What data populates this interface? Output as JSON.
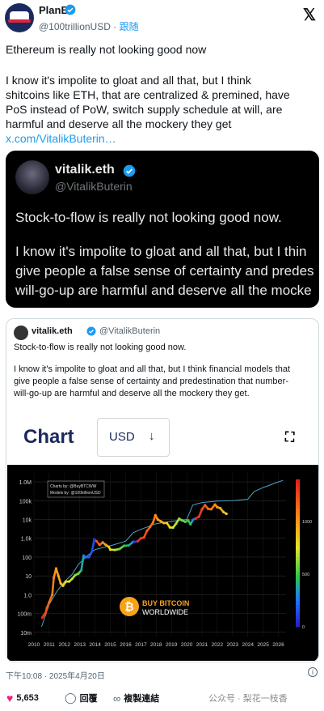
{
  "author": {
    "name": "PlanB",
    "handle": "@100trillionUSD",
    "follow": "跟随"
  },
  "tweet": {
    "line1": "Ethereum is really not looking good now",
    "body_lines": [
      "I know it's impolite to gloat and all that, but I think",
      "shitcoins like ETH, that are centralized & premined, have",
      "PoS instead of PoW, switch supply schedule at will, are",
      "harmful and deserve all the mockery they get"
    ],
    "link": "x.com/VitalikButerin…"
  },
  "image_card": {
    "name": "vitalik.eth",
    "handle": "@VitalikButerin",
    "line1": "Stock-to-flow is really not looking good now.",
    "line2": "I know it's impolite to gloat and all that, but I thin",
    "line3": "give people a false sense of certainty and predes",
    "line4": "will-go-up are harmful and deserve all the mocke"
  },
  "quoted": {
    "name": "vitalik.eth",
    "handle": "@VitalikButerin",
    "line1": "Stock-to-flow is really not looking good now.",
    "para_lines": [
      "I know it's impolite to gloat and all that, but I think financial models that",
      "give people a false sense of certainty and predestination that number-",
      "will-go-up are harmful and deserve all the mockery they get."
    ]
  },
  "chart_widget": {
    "title": "Chart",
    "currency": "USD",
    "dropdown_icon": "arrow-down-icon",
    "fullscreen_icon": "expand-icon"
  },
  "chart_data": {
    "type": "scatter",
    "legend_box": [
      "Charts by: @BuyBTCWW",
      "Models by: @100trillionUSD"
    ],
    "brand_lines": [
      "BUY BITCOIN",
      "WORLDWIDE"
    ],
    "y_tick_labels": [
      "1.0M",
      "100k",
      "10k",
      "1.0k",
      "100",
      "10",
      "1.0",
      "100m",
      "10m"
    ],
    "y_tick_values": [
      1000000,
      100000,
      10000,
      1000,
      100,
      10,
      1,
      0.1,
      0.01
    ],
    "x_tick_labels": [
      "2010",
      "2011",
      "2012",
      "2013",
      "2014",
      "2015",
      "2016",
      "2017",
      "2018",
      "2019",
      "2020",
      "2021",
      "2022",
      "2023",
      "2024",
      "2025",
      "2026"
    ],
    "ylim": [
      0.006,
      3000000
    ],
    "xlim": [
      2010,
      2026.5
    ],
    "yscale": "log",
    "colorbar_ticks": [
      "1000",
      "500",
      "0"
    ],
    "colorbar_range": [
      0,
      1400
    ],
    "price_points": [
      [
        2010.55,
        0.06,
        1350
      ],
      [
        2010.65,
        0.08,
        1300
      ],
      [
        2010.75,
        0.1,
        1250
      ],
      [
        2010.85,
        0.2,
        1200
      ],
      [
        2011.0,
        0.4,
        1150
      ],
      [
        2011.2,
        1,
        1100
      ],
      [
        2011.3,
        8,
        1050
      ],
      [
        2011.45,
        25,
        1000
      ],
      [
        2011.6,
        10,
        950
      ],
      [
        2011.75,
        4,
        900
      ],
      [
        2011.9,
        3,
        850
      ],
      [
        2012.1,
        5,
        800
      ],
      [
        2012.3,
        5,
        750
      ],
      [
        2012.5,
        7,
        700
      ],
      [
        2012.7,
        11,
        650
      ],
      [
        2012.9,
        13,
        600
      ],
      [
        2013.1,
        20,
        400
      ],
      [
        2013.25,
        120,
        300
      ],
      [
        2013.4,
        100,
        250
      ],
      [
        2013.6,
        100,
        200
      ],
      [
        2013.8,
        200,
        150
      ],
      [
        2013.95,
        900,
        100
      ],
      [
        2014.1,
        700,
        1250
      ],
      [
        2014.3,
        450,
        1150
      ],
      [
        2014.5,
        600,
        1050
      ],
      [
        2014.7,
        450,
        950
      ],
      [
        2014.9,
        350,
        850
      ],
      [
        2015.0,
        250,
        800
      ],
      [
        2015.3,
        240,
        700
      ],
      [
        2015.6,
        270,
        600
      ],
      [
        2015.9,
        400,
        500
      ],
      [
        2016.2,
        420,
        400
      ],
      [
        2016.5,
        650,
        300
      ],
      [
        2016.6,
        650,
        100
      ],
      [
        2016.8,
        700,
        1350
      ],
      [
        2017.0,
        1000,
        1300
      ],
      [
        2017.2,
        1100,
        1250
      ],
      [
        2017.4,
        2500,
        1200
      ],
      [
        2017.6,
        4000,
        1150
      ],
      [
        2017.8,
        7000,
        1100
      ],
      [
        2017.95,
        17000,
        1050
      ],
      [
        2018.1,
        10000,
        1000
      ],
      [
        2018.3,
        8000,
        950
      ],
      [
        2018.5,
        6500,
        900
      ],
      [
        2018.7,
        6500,
        850
      ],
      [
        2018.9,
        3800,
        800
      ],
      [
        2019.1,
        3700,
        750
      ],
      [
        2019.3,
        6000,
        700
      ],
      [
        2019.5,
        11000,
        650
      ],
      [
        2019.7,
        9000,
        600
      ],
      [
        2019.9,
        7500,
        550
      ],
      [
        2020.1,
        9000,
        500
      ],
      [
        2020.25,
        5500,
        450
      ],
      [
        2020.4,
        9500,
        300
      ],
      [
        2020.6,
        11500,
        1350
      ],
      [
        2020.8,
        14000,
        1300
      ],
      [
        2021.0,
        35000,
        1250
      ],
      [
        2021.2,
        58000,
        1200
      ],
      [
        2021.4,
        37000,
        1150
      ],
      [
        2021.6,
        35000,
        1100
      ],
      [
        2021.85,
        62000,
        1050
      ],
      [
        2022.0,
        45000,
        1000
      ],
      [
        2022.2,
        40000,
        950
      ],
      [
        2022.4,
        25000,
        900
      ],
      [
        2022.6,
        20000,
        850
      ]
    ],
    "model_line": [
      [
        2010.5,
        0.02
      ],
      [
        2011.0,
        0.3
      ],
      [
        2011.5,
        1.5
      ],
      [
        2012.0,
        5
      ],
      [
        2012.5,
        12
      ],
      [
        2012.9,
        40
      ],
      [
        2013.5,
        120
      ],
      [
        2014.0,
        250
      ],
      [
        2015.0,
        400
      ],
      [
        2016.0,
        700
      ],
      [
        2016.5,
        2000
      ],
      [
        2017.0,
        3000
      ],
      [
        2018.0,
        6000
      ],
      [
        2019.0,
        8000
      ],
      [
        2020.0,
        10000
      ],
      [
        2020.4,
        60000
      ],
      [
        2021.0,
        80000
      ],
      [
        2022.0,
        95000
      ],
      [
        2023.0,
        100000
      ],
      [
        2024.0,
        120000
      ],
      [
        2024.4,
        300000
      ],
      [
        2025.0,
        500000
      ],
      [
        2026.0,
        1000000
      ],
      [
        2026.3,
        1200000
      ]
    ]
  },
  "footer": {
    "timestamp": "下午10:08 · 2025年4月20日",
    "info": "i"
  },
  "actions": {
    "likes": "5,653",
    "reply": "回覆",
    "copy_link": "複製連結",
    "watermark": "公众号 · 梨花一枝香"
  }
}
